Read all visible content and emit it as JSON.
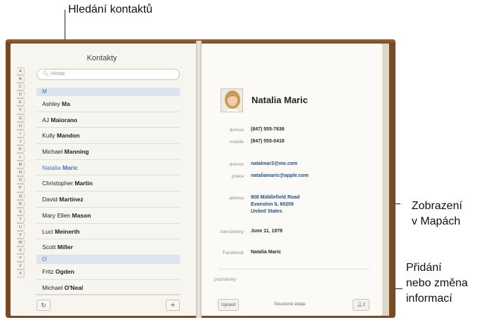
{
  "callouts": {
    "search": "Hledání kontaktů",
    "maps_line1": "Zobrazení",
    "maps_line2": "v Mapách",
    "edit_line1": "Přidání",
    "edit_line2": "nebo změna",
    "edit_line3": "informací"
  },
  "left_page": {
    "title": "Kontakty",
    "search_placeholder": "Hledat",
    "index_letters": [
      "A",
      "B",
      "C",
      "D",
      "E",
      "F",
      "G",
      "H",
      "I",
      "J",
      "K",
      "L",
      "M",
      "N",
      "O",
      "P",
      "Q",
      "R",
      "S",
      "T",
      "U",
      "V",
      "W",
      "X",
      "Y",
      "Z",
      "#"
    ],
    "sections": [
      {
        "letter": "M",
        "rows": [
          {
            "first": "Ashley",
            "last": "Ma"
          },
          {
            "first": "AJ",
            "last": "Maiorano"
          },
          {
            "first": "Kully",
            "last": "Mandon"
          },
          {
            "first": "Michael",
            "last": "Manning"
          },
          {
            "first": "Natalia",
            "last": "Maric",
            "selected": true
          },
          {
            "first": "Christopher",
            "last": "Martin"
          },
          {
            "first": "David",
            "last": "Martinez"
          },
          {
            "first": "Mary Ellen",
            "last": "Mason"
          },
          {
            "first": "Luci",
            "last": "Meinerth"
          },
          {
            "first": "Scott",
            "last": "Miller"
          }
        ]
      },
      {
        "letter": "O",
        "rows": [
          {
            "first": "Fritz",
            "last": "Ogden"
          },
          {
            "first": "Michael",
            "last": "O'Neal"
          }
        ]
      }
    ],
    "refresh_icon": "refresh-icon",
    "add_label": "+"
  },
  "right_page": {
    "name": "Natalia Maric",
    "fields": {
      "phone_home_label": "domov",
      "phone_home": "(847) 555-7636",
      "mobile_label": "mobile",
      "mobile": "(847) 555-0418",
      "email_home_label": "domov",
      "email_home": "natalmar3@me.com",
      "email_work_label": "práce",
      "email_work": "nataliamaric@apple.com",
      "address_label": "adresa",
      "address_line1": "908 Middlefield Road",
      "address_line2": "Evanston IL 60208",
      "address_line3": "United States",
      "birthday_label": "narozeniny",
      "birthday": "June 11, 1978",
      "facebook_label": "Facebook",
      "facebook": "Natalia Maric",
      "notes_label": "poznámky"
    },
    "edit_label": "Upravit",
    "linked_label": "Sloučené údaje",
    "linked_count": "2"
  },
  "colors": {
    "book_leather": "#7a4a24",
    "selected_text": "#3d6ec9",
    "section_header": "#dbe4ef"
  }
}
